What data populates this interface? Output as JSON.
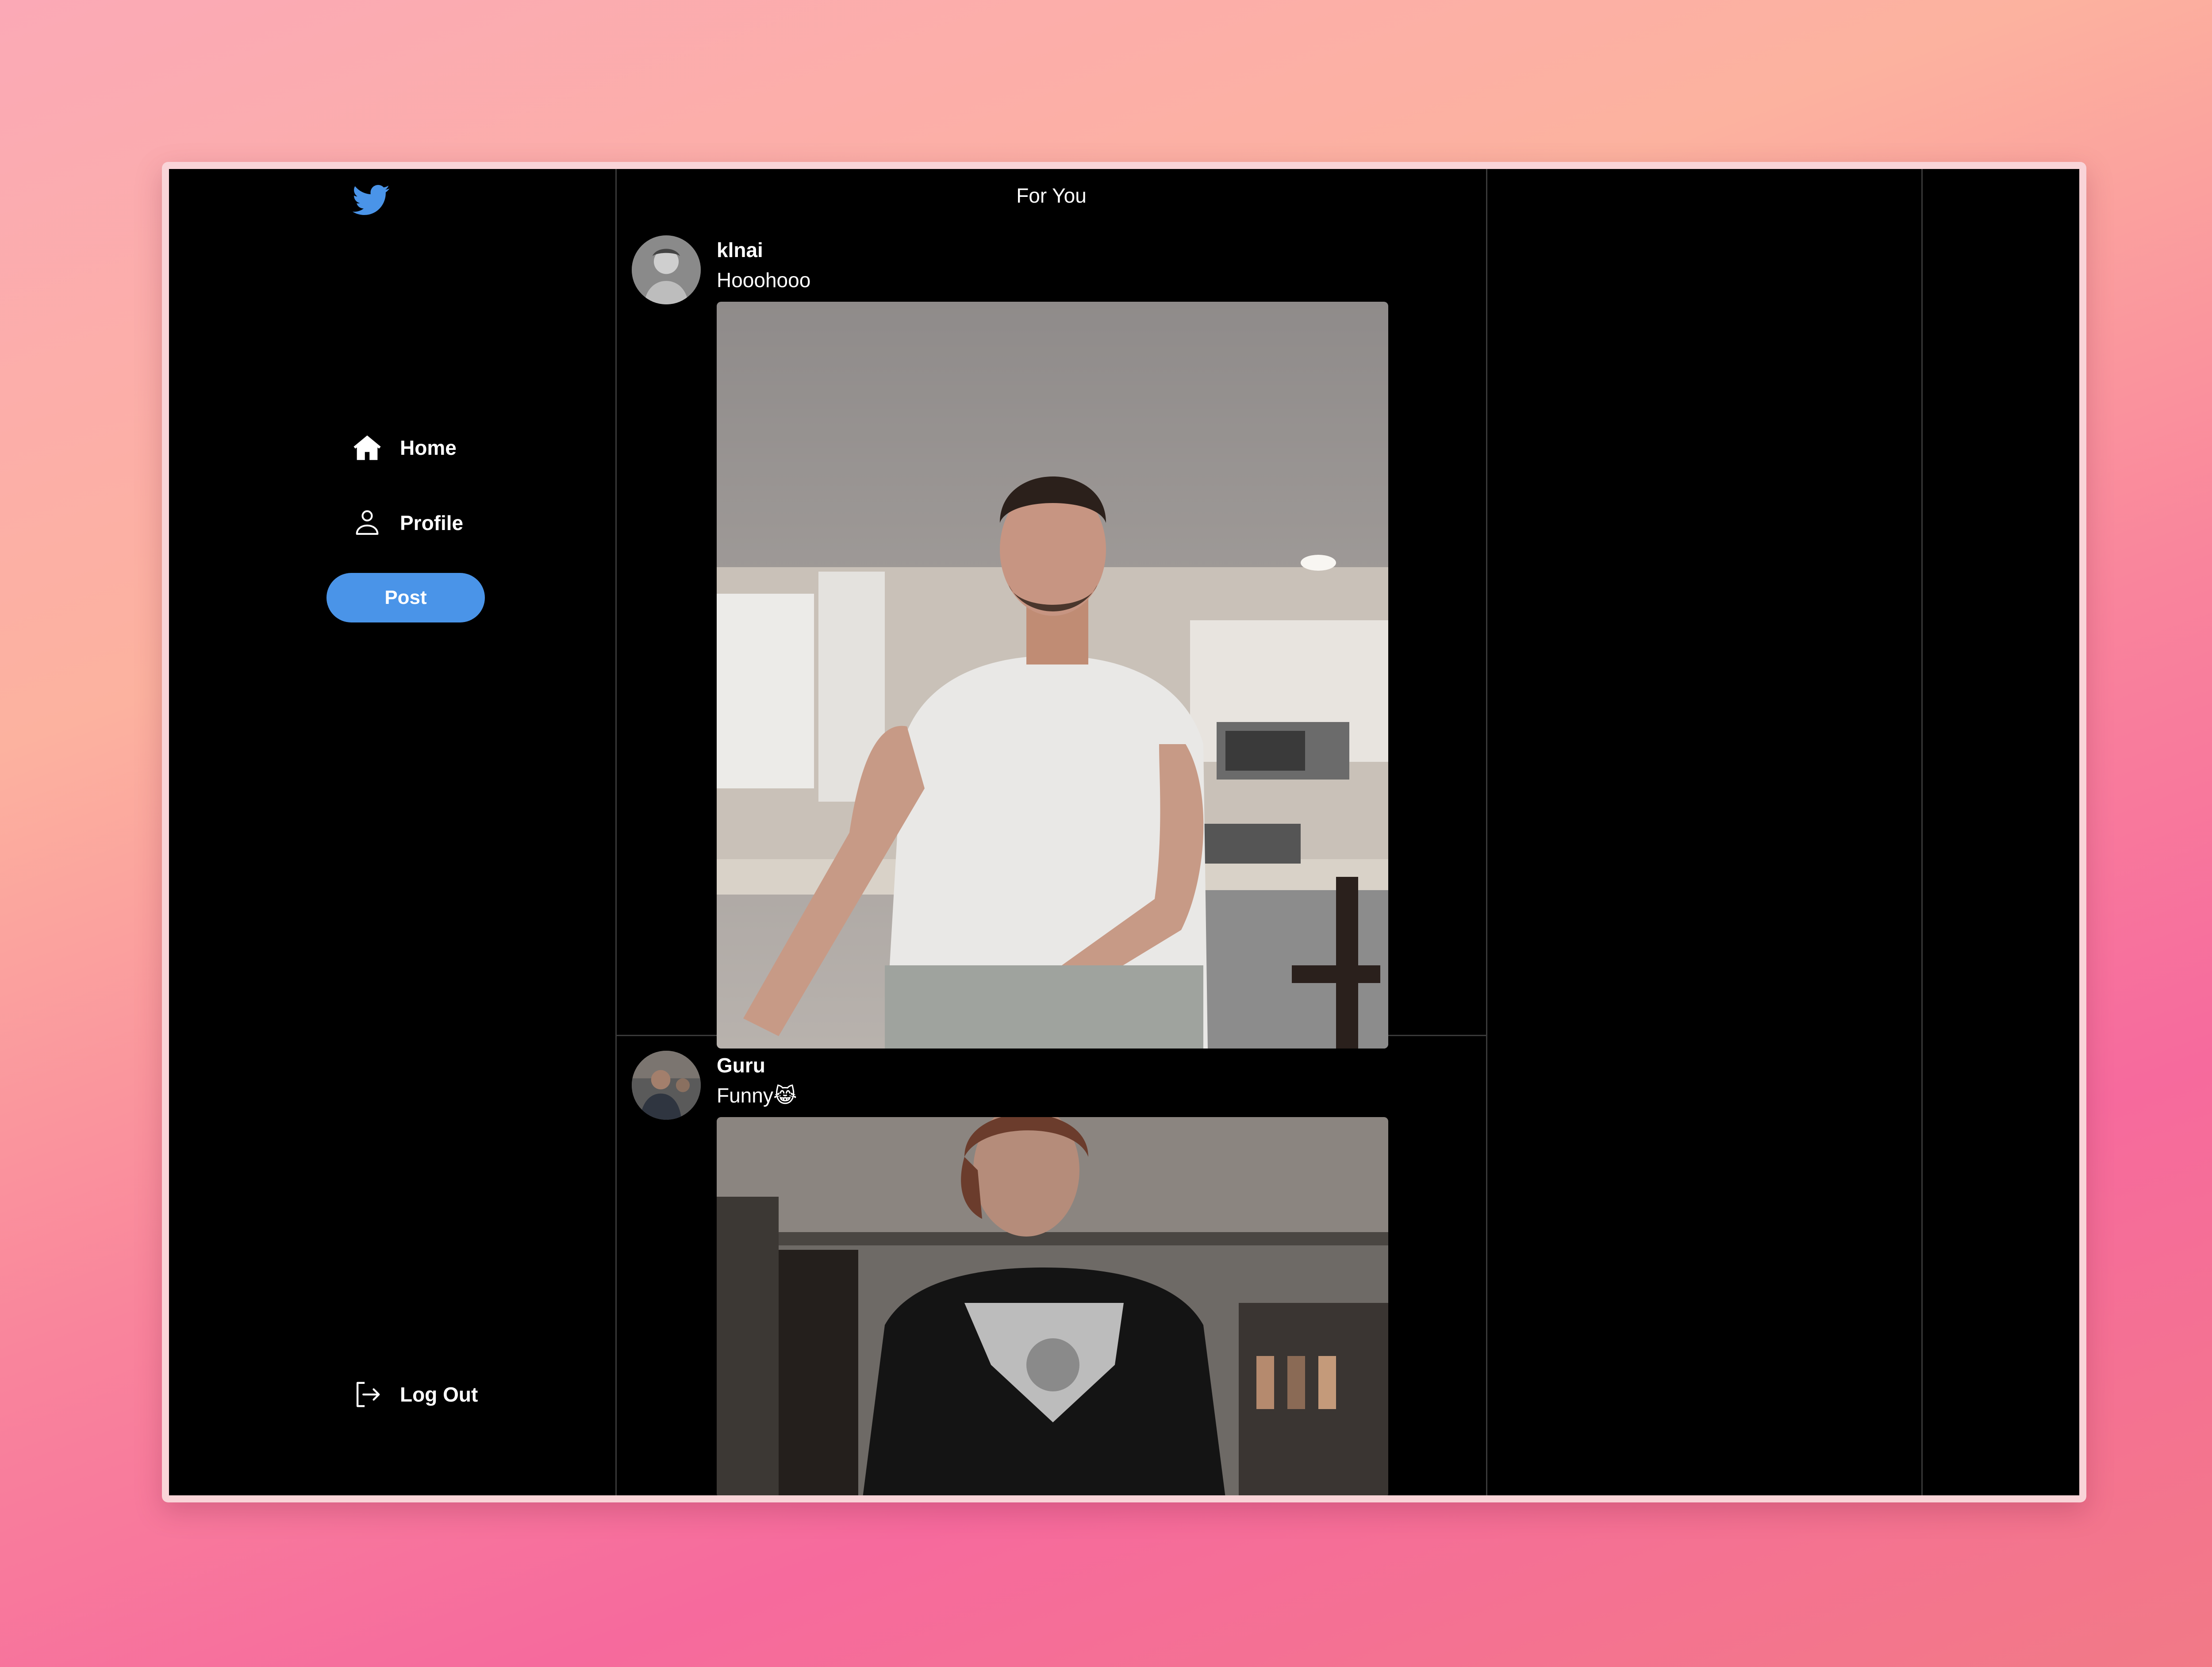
{
  "app": {
    "logo_icon": "twitter-bird-icon",
    "accent_color": "#4a94e8"
  },
  "sidebar": {
    "items": [
      {
        "label": "Home",
        "icon": "home-icon"
      },
      {
        "label": "Profile",
        "icon": "user-icon"
      }
    ],
    "post_label": "Post",
    "logout_label": "Log Out",
    "logout_icon": "logout-icon"
  },
  "feed": {
    "header": "For You",
    "tweets": [
      {
        "username": "klnai",
        "text": "Hooohooo",
        "media": "video-thumbnail"
      },
      {
        "username": "Guru",
        "text": "Funny😹",
        "media": "video-thumbnail"
      }
    ]
  }
}
